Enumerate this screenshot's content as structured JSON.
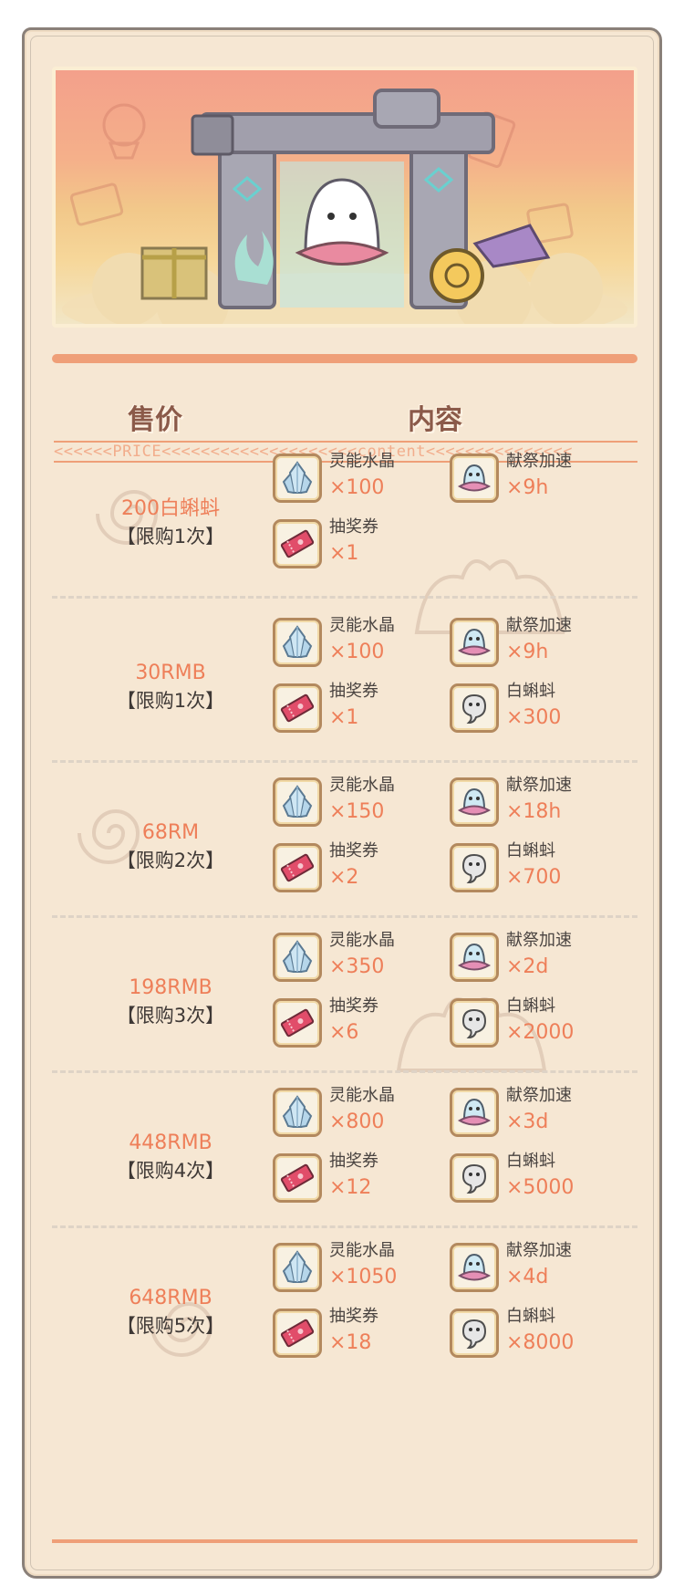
{
  "header": {
    "price_label": "售价",
    "content_label": "内容"
  },
  "ribbon_text": "<<<<<<PRICE<<<<<<<<<<<<<<<<<<<<content<<<<<<<<<<<<<<<",
  "colors": {
    "accent": "#ee7f59",
    "bar": "#ef9f78",
    "card_bg": "#f6e7d3",
    "frame": "#b3895e"
  },
  "rows": [
    {
      "price": "200白蝌蚪",
      "limit": "【限购1次】",
      "items": [
        {
          "icon": "crystal-icon",
          "name": "灵能水晶",
          "qty": "×100"
        },
        {
          "icon": "ghost-speed-icon",
          "name": "献祭加速",
          "qty": "×9h"
        },
        {
          "icon": "ticket-icon",
          "name": "抽奖券",
          "qty": "×1"
        }
      ]
    },
    {
      "price": "30RMB",
      "limit": "【限购1次】",
      "items": [
        {
          "icon": "crystal-icon",
          "name": "灵能水晶",
          "qty": "×100"
        },
        {
          "icon": "ghost-speed-icon",
          "name": "献祭加速",
          "qty": "×9h"
        },
        {
          "icon": "ticket-icon",
          "name": "抽奖券",
          "qty": "×1"
        },
        {
          "icon": "tadpole-icon",
          "name": "白蝌蚪",
          "qty": "×300"
        }
      ]
    },
    {
      "price": "68RM",
      "limit": "【限购2次】",
      "items": [
        {
          "icon": "crystal-icon",
          "name": "灵能水晶",
          "qty": "×150"
        },
        {
          "icon": "ghost-speed-icon",
          "name": "献祭加速",
          "qty": "×18h"
        },
        {
          "icon": "ticket-icon",
          "name": "抽奖券",
          "qty": "×2"
        },
        {
          "icon": "tadpole-icon",
          "name": "白蝌蚪",
          "qty": "×700"
        }
      ]
    },
    {
      "price": "198RMB",
      "limit": "【限购3次】",
      "items": [
        {
          "icon": "crystal-icon",
          "name": "灵能水晶",
          "qty": "×350"
        },
        {
          "icon": "ghost-speed-icon",
          "name": "献祭加速",
          "qty": "×2d"
        },
        {
          "icon": "ticket-icon",
          "name": "抽奖券",
          "qty": "×6"
        },
        {
          "icon": "tadpole-icon",
          "name": "白蝌蚪",
          "qty": "×2000"
        }
      ]
    },
    {
      "price": "448RMB",
      "limit": "【限购4次】",
      "items": [
        {
          "icon": "crystal-icon",
          "name": "灵能水晶",
          "qty": "×800"
        },
        {
          "icon": "ghost-speed-icon",
          "name": "献祭加速",
          "qty": "×3d"
        },
        {
          "icon": "ticket-icon",
          "name": "抽奖券",
          "qty": "×12"
        },
        {
          "icon": "tadpole-icon",
          "name": "白蝌蚪",
          "qty": "×5000"
        }
      ]
    },
    {
      "price": "648RMB",
      "limit": "【限购5次】",
      "items": [
        {
          "icon": "crystal-icon",
          "name": "灵能水晶",
          "qty": "×1050"
        },
        {
          "icon": "ghost-speed-icon",
          "name": "献祭加速",
          "qty": "×4d"
        },
        {
          "icon": "ticket-icon",
          "name": "抽奖券",
          "qty": "×18"
        },
        {
          "icon": "tadpole-icon",
          "name": "白蝌蚪",
          "qty": "×8000"
        }
      ]
    }
  ]
}
